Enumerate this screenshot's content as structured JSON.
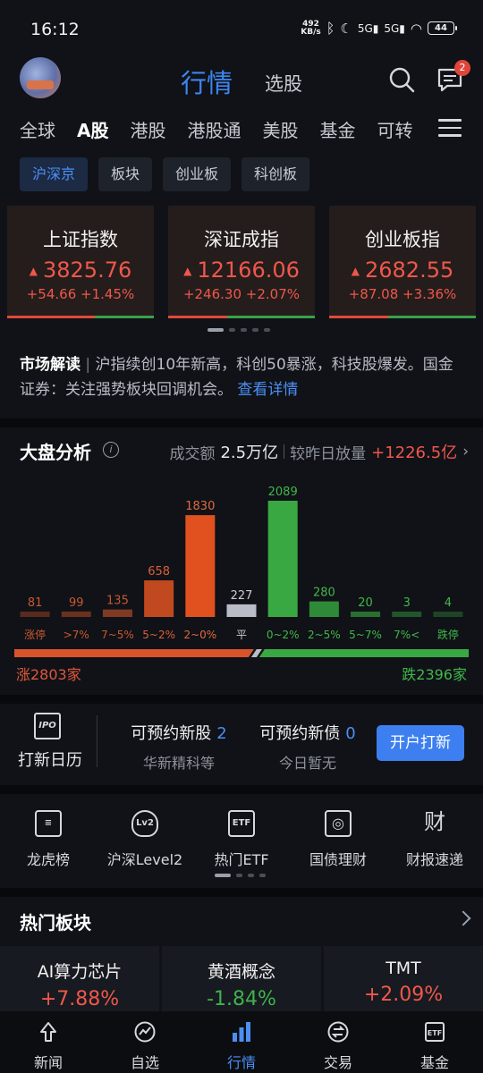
{
  "status": {
    "time": "16:12",
    "net_speed": "492",
    "net_unit": "KB/s",
    "battery": "44",
    "signal1": "5G",
    "signal2": "5G"
  },
  "header": {
    "title": "行情",
    "sub_tab": "选股",
    "msg_badge": "2"
  },
  "market_tabs": [
    "全球",
    "A股",
    "港股",
    "港股通",
    "美股",
    "基金",
    "可转"
  ],
  "sub_tabs": [
    "沪深京",
    "板块",
    "创业板",
    "科创板"
  ],
  "indices": [
    {
      "name": "上证指数",
      "value": "3825.76",
      "change": "+54.66",
      "pct": "+1.45%",
      "up_ratio": 0.6
    },
    {
      "name": "深证成指",
      "value": "12166.06",
      "change": "+246.30",
      "pct": "+2.07%",
      "up_ratio": 0.4
    },
    {
      "name": "创业板指",
      "value": "2682.55",
      "change": "+87.08",
      "pct": "+3.36%",
      "up_ratio": 0.4
    }
  ],
  "news": {
    "tag": "市场解读",
    "text": "沪指续创10年新高，科创50暴涨，科技股爆发。国金证券：关注强势板块回调机会。",
    "link": "查看详情"
  },
  "board": {
    "title": "大盘分析",
    "turnover_label": "成交额",
    "turnover_value": "2.5万亿",
    "vs_label": "较昨日放量",
    "vs_value": "+1226.5亿",
    "up_label": "涨2803家",
    "down_label": "跌2396家",
    "up_count": 2803,
    "down_count": 2396
  },
  "chart_data": {
    "type": "bar",
    "categories": [
      "涨停",
      ">7%",
      "7~5%",
      "5~2%",
      "2~0%",
      "平",
      "0~2%",
      "2~5%",
      "5~7%",
      "7%<",
      "跌停"
    ],
    "values": [
      81,
      99,
      135,
      658,
      1830,
      227,
      2089,
      280,
      20,
      3,
      4
    ],
    "colors": [
      "#5a2a1e",
      "#6a301f",
      "#7e3a22",
      "#c1491f",
      "#e0511f",
      "#b8bcc6",
      "#3aa842",
      "#2f8a37",
      "#2a6e30",
      "#22552a",
      "#1f4425"
    ],
    "label_colors": [
      "#c8582f",
      "#c8582f",
      "#c8582f",
      "#d8603a",
      "#e06a40",
      "#c9ccd4",
      "#41b74a",
      "#41b74a",
      "#41b74a",
      "#41b74a",
      "#41b74a"
    ],
    "ylim": [
      0,
      2089
    ]
  },
  "ipo": {
    "calendar": "打新日历",
    "stock_label": "可预约新股",
    "stock_count": "2",
    "stock_sub": "华新精科等",
    "bond_label": "可预约新债",
    "bond_count": "0",
    "bond_sub": "今日暂无",
    "button": "开户打新"
  },
  "tools": [
    {
      "label": "龙虎榜",
      "icon": "list-doc-icon",
      "glyph": "≡"
    },
    {
      "label": "沪深Level2",
      "icon": "lv2-icon",
      "glyph": "Lv2"
    },
    {
      "label": "热门ETF",
      "icon": "etf-icon",
      "glyph": "ETF"
    },
    {
      "label": "国债理财",
      "icon": "bond-icon",
      "glyph": "◎"
    },
    {
      "label": "财报速递",
      "icon": "report-icon",
      "glyph": "财"
    }
  ],
  "hot": {
    "title": "热门板块",
    "sectors": [
      {
        "name": "AI算力芯片",
        "pct": "+7.88%",
        "color": "#f0574b"
      },
      {
        "name": "黄酒概念",
        "pct": "-1.84%",
        "color": "#3fb24a"
      },
      {
        "name": "TMT",
        "pct": "+2.09%",
        "color": "#f0574b"
      }
    ]
  },
  "nav": [
    {
      "label": "新闻",
      "icon": "news-icon"
    },
    {
      "label": "自选",
      "icon": "watchlist-icon"
    },
    {
      "label": "行情",
      "icon": "market-icon"
    },
    {
      "label": "交易",
      "icon": "trade-icon"
    },
    {
      "label": "基金",
      "icon": "fund-icon"
    }
  ],
  "colors": {
    "accent": "#3d86f2",
    "up": "#f0574b",
    "down": "#3fb24a"
  }
}
